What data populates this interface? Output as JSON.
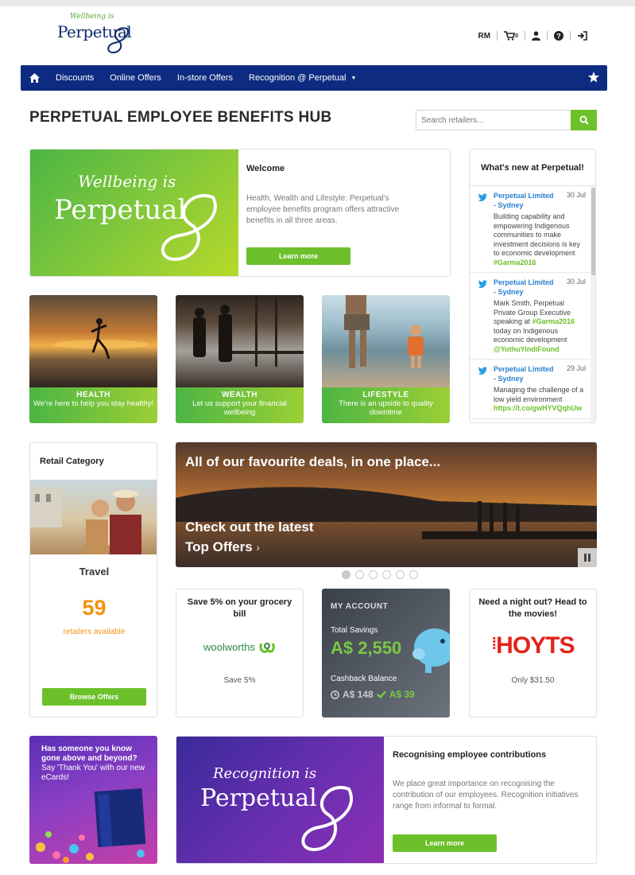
{
  "header": {
    "logo_tagline": "Wellbeing is",
    "logo_word": "Perpetual",
    "user_initials": "RM",
    "cart_count": "0"
  },
  "nav": {
    "items": [
      "Discounts",
      "Online Offers",
      "In-store Offers",
      "Recognition @ Perpetual"
    ]
  },
  "page": {
    "title": "PERPETUAL EMPLOYEE BENEFITS HUB"
  },
  "search": {
    "placeholder": "Search retailers..."
  },
  "welcome": {
    "art_line1": "Wellbeing is",
    "art_line2": "Perpetual",
    "heading": "Welcome",
    "body": "Health, Wealth and Lifestyle: Perpetual's employee benefits program offers attractive benefits in all three areas.",
    "button": "Learn more"
  },
  "whats_new": {
    "heading": "What's new at Perpetual!",
    "tweets": [
      {
        "author": "Perpetual Limited - Sydney",
        "date": "30 Jul",
        "text": "Building capability and empowering Indigenous communities to make investment decisions is key to economic development",
        "tag": "#Garma2016"
      },
      {
        "author": "Perpetual Limited - Sydney",
        "date": "30 Jul",
        "text_before": "Mark Smith, Perpetual Private Group Executive speaking at",
        "tag": "#Garma2016",
        "text_after": "today on Indigenous economic development",
        "mention": "@YothuYindiFound"
      },
      {
        "author": "Perpetual Limited - Sydney",
        "date": "29 Jul",
        "text": "Managing the challenge of a low yield environment",
        "link": "https://t.co/gwHYVQqhUw"
      }
    ]
  },
  "tiles": [
    {
      "title": "HEALTH",
      "subtitle": "We're here to help you stay healthy!"
    },
    {
      "title": "WEALTH",
      "subtitle": "Let us support your financial wellbeing"
    },
    {
      "title": "LIFESTYLE",
      "subtitle": "There is an upside to quality downtime"
    }
  ],
  "retail": {
    "heading": "Retail Category",
    "category": "Travel",
    "count": "59",
    "count_label": "retailers available",
    "button": "Browse Offers"
  },
  "banner": {
    "headline": "All of our favourite deals, in one place...",
    "cta_line1": "Check out the latest",
    "cta_line2": "Top Offers",
    "slide_count": 6,
    "active_slide": 1
  },
  "offers": {
    "grocery": {
      "heading": "Save 5% on your grocery bill",
      "brand": "woolworths",
      "footer": "Save 5%"
    },
    "movies": {
      "heading": "Need a night out? Head to the movies!",
      "brand": "HOYTS",
      "footer": "Only $31.50"
    }
  },
  "account": {
    "heading": "MY ACCOUNT",
    "savings_label": "Total Savings",
    "savings_value": "A$ 2,550",
    "cashback_label": "Cashback Balance",
    "cashback_pending": "A$ 148",
    "cashback_confirmed": "A$ 39"
  },
  "ecards": {
    "line1": "Has someone you know gone above and beyond?",
    "line2": "Say 'Thank You' with our new eCards!"
  },
  "recognition": {
    "art_line1": "Recognition is",
    "art_line2": "Perpetual",
    "heading": "Recognising employee contributions",
    "body": "We place great importance on recognising the contribution of our employees. Recognition initiatives range from informal to formal.",
    "button": "Learn more"
  },
  "colors": {
    "nav_blue": "#0d2b80",
    "brand_green": "#6cc02a",
    "accent_orange": "#f49212",
    "twitter_blue": "#2a7fd0",
    "hoyts_red": "#e2231a"
  }
}
